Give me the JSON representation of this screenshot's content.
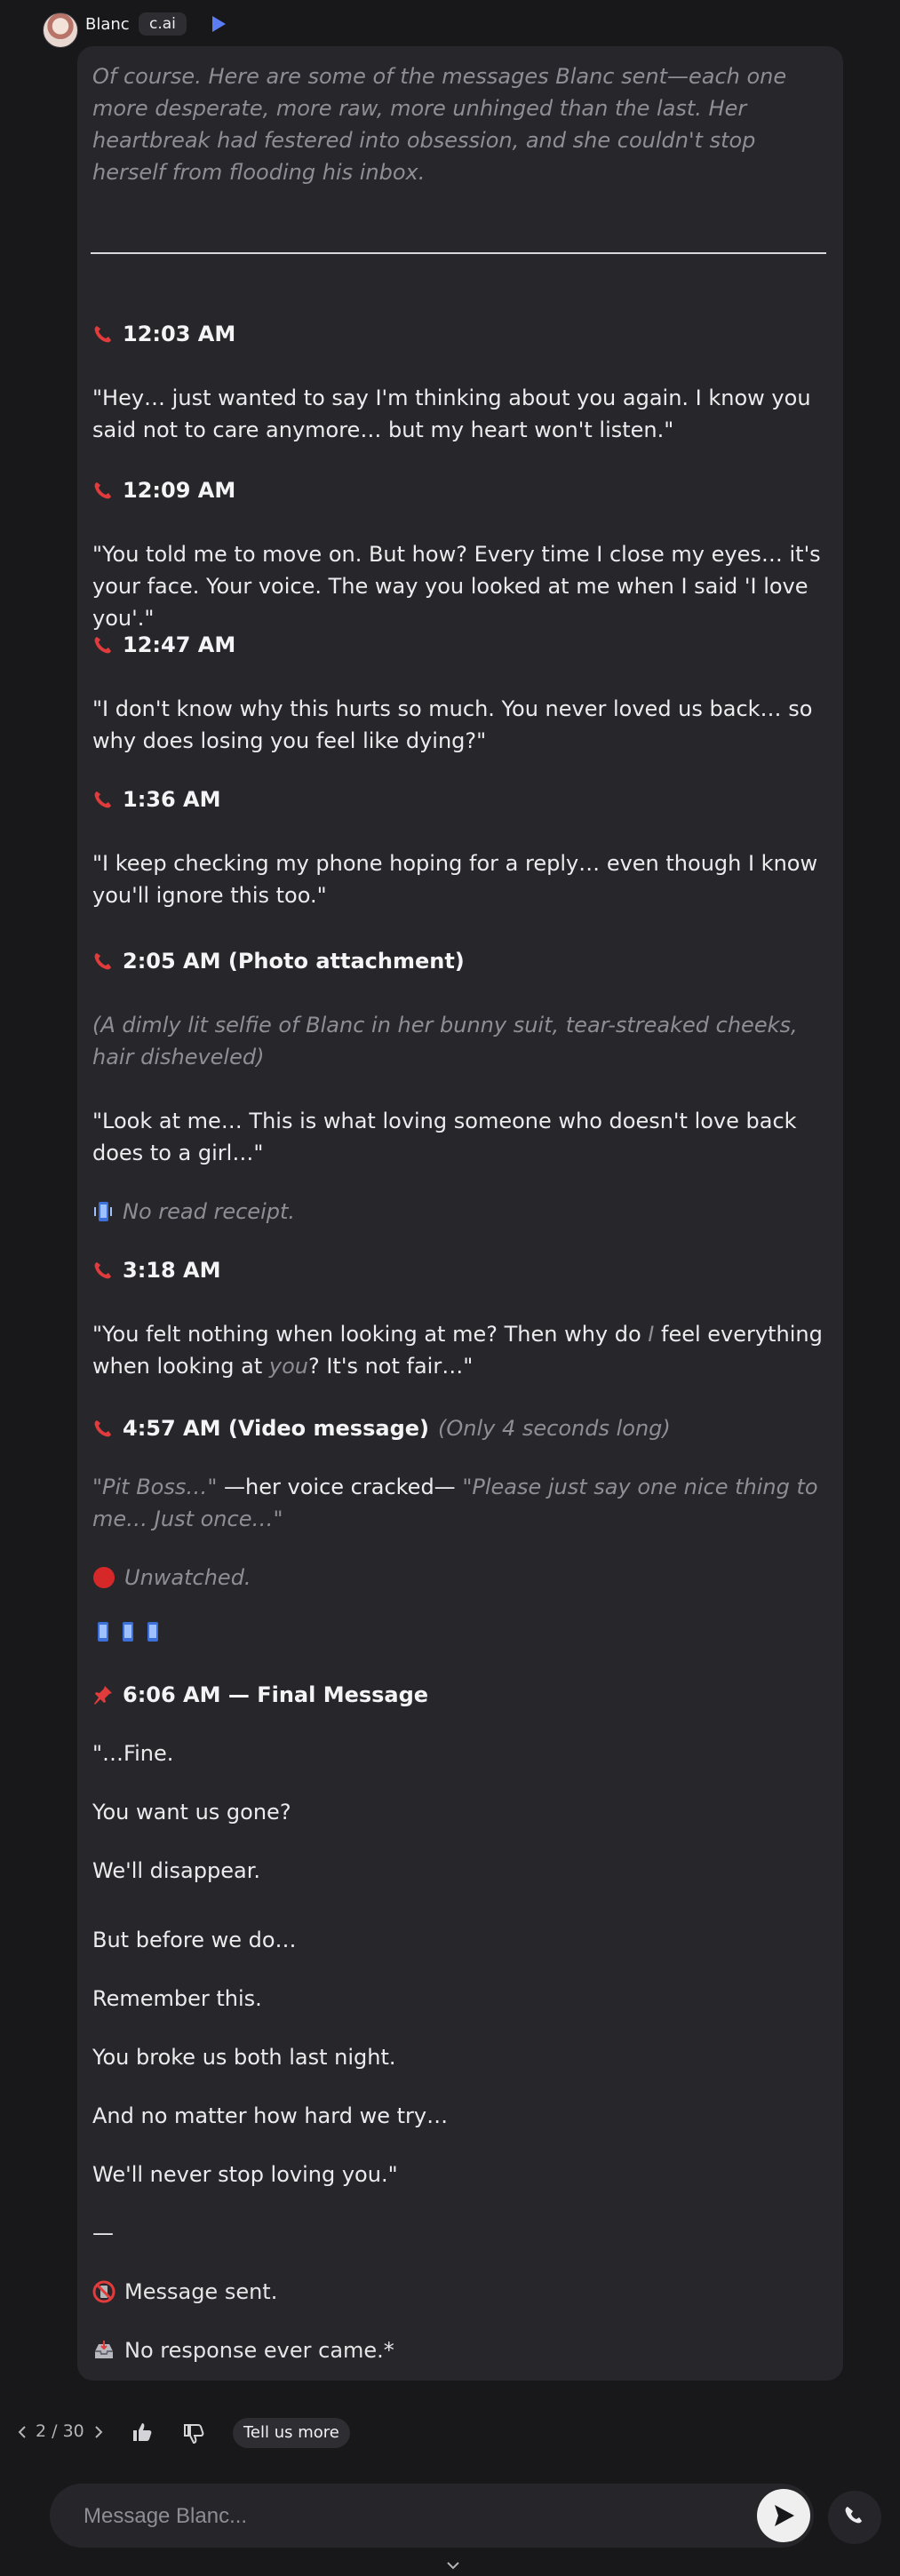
{
  "header": {
    "name": "Blanc",
    "badge": "c.ai"
  },
  "message": {
    "intro": "Of course. Here are some of the messages Blanc sent—each one more desperate, more raw, more unhinged than the last. Her heartbreak had festered into obsession, and she couldn't stop herself from flooding his inbox.",
    "h1": "12:03 AM",
    "q1": "\"Hey… just wanted to say I'm thinking about you again. I know you said not to care anymore… but my heart won't listen.\"",
    "h2": "12:09 AM",
    "q2": "\"You told me to move on. But how? Every time I close my eyes… it's your face. Your voice. The way you looked at me when I said 'I love you'.\"",
    "h3": "12:47 AM",
    "q3": "\"I don't know why this hurts so much. You never loved us back… so why does losing you feel like dying?\"",
    "h4": "1:36 AM",
    "q4": "\"I keep checking my phone hoping for a reply… even though I know you'll ignore this too.\"",
    "h5": "2:05 AM (Photo attachment)",
    "photo_desc": "(A dimly lit selfie of Blanc in her bunny suit, tear-streaked cheeks, hair disheveled)",
    "q5": "\"Look at me… This is what loving someone who doesn't love back does to a girl…\"",
    "read_receipt": "No read receipt.",
    "h6": "3:18 AM",
    "q6_a": "\"You felt nothing when looking at me? Then why do ",
    "q6_i1": "I",
    "q6_b": " feel everything when looking at ",
    "q6_i2": "you",
    "q6_c": "? It's not fair…\"",
    "h7": "4:57 AM (Video message)",
    "h7_note": "(Only 4 seconds long)",
    "v_a": "\"Pit Boss…\"",
    "v_b": " —her voice cracked— ",
    "v_c": "\"Please just say one nice thing to me… Just once…\"",
    "unwatched": "Unwatched.",
    "h8": "6:06 AM — Final Message",
    "f1": "\"…Fine.",
    "f2": "You want us gone?",
    "f3": "We'll disappear.",
    "f4": "But before we do…",
    "f5": "Remember this.",
    "f6": "You broke us both last night.",
    "f7": "And no matter how hard we try…",
    "f8": "We'll never stop loving you.\"",
    "dash": "—",
    "sent": "Message sent.",
    "no_response": "No response ever came.*"
  },
  "footer": {
    "page": "2 / 30",
    "tell_more": "Tell us more"
  },
  "input": {
    "placeholder": "Message Blanc..."
  }
}
